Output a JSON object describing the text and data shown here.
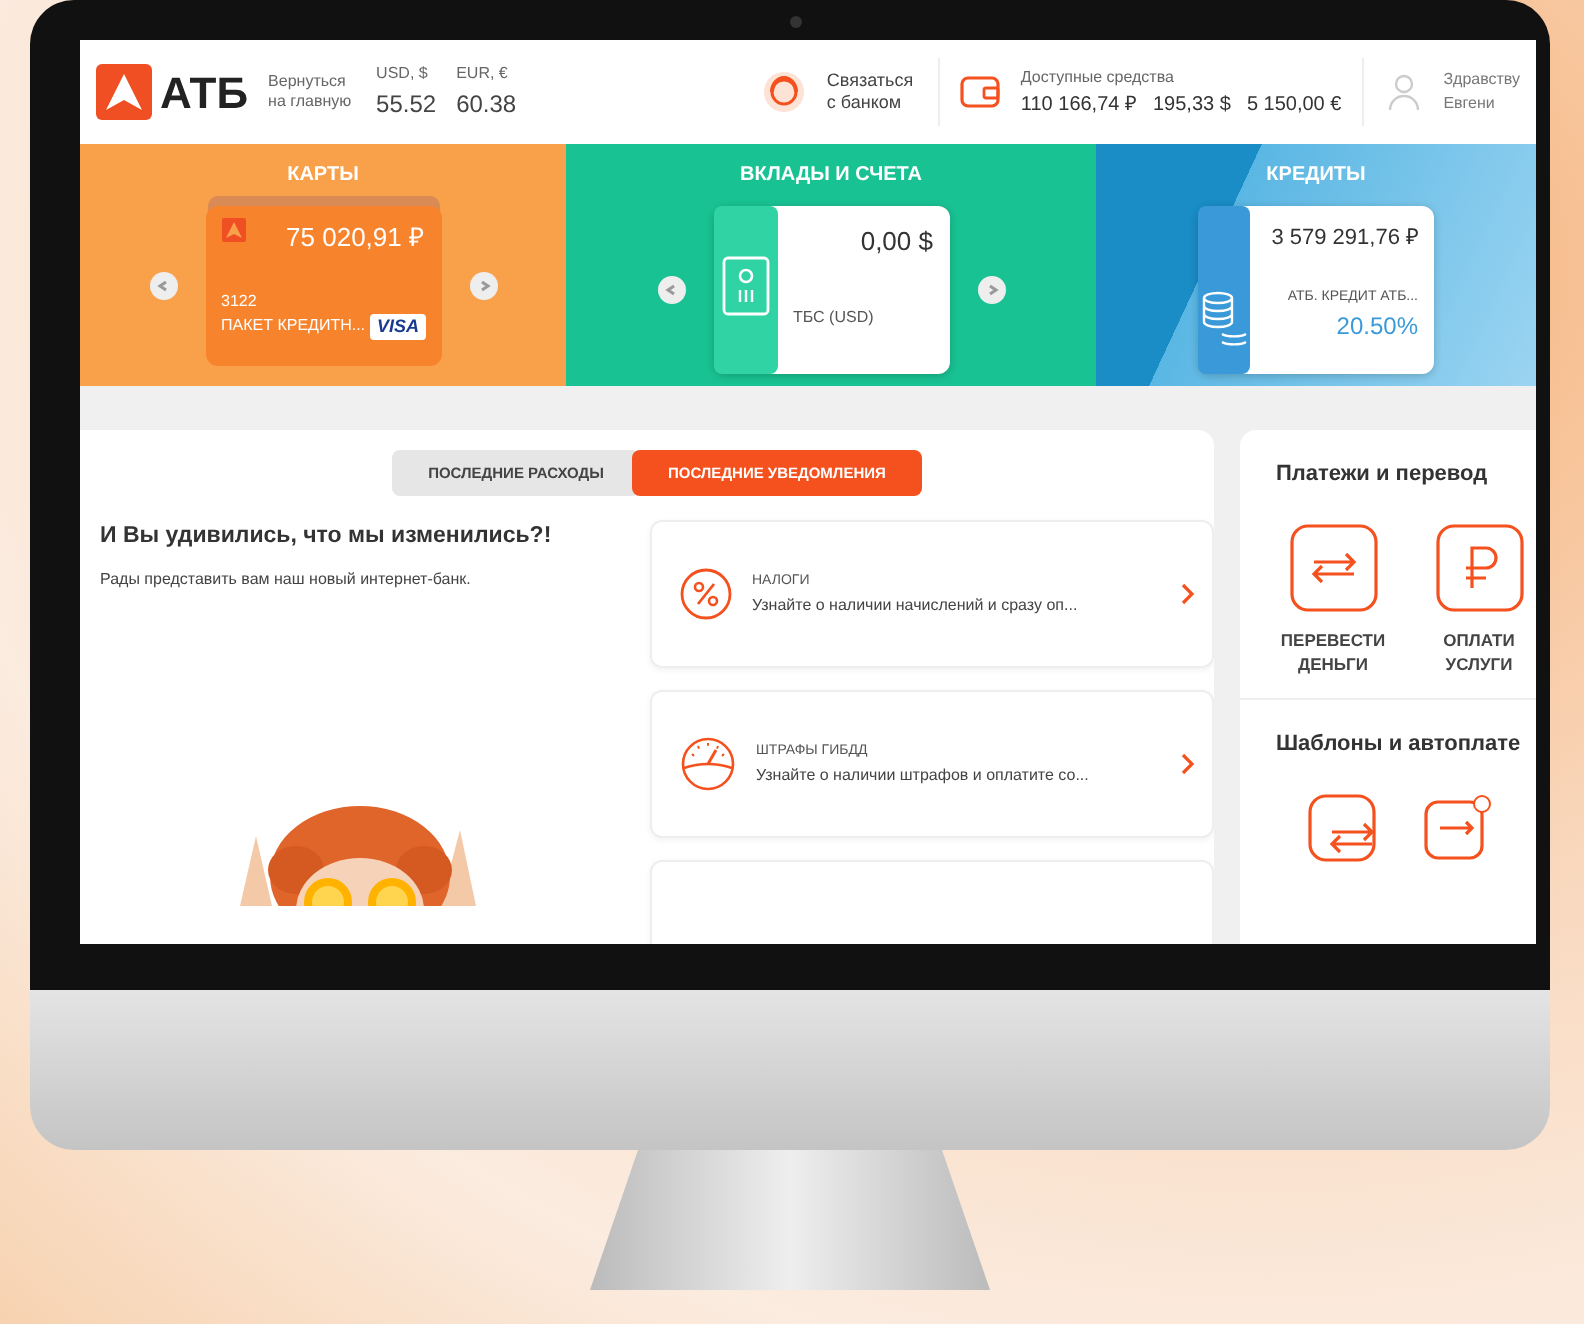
{
  "header": {
    "logo": "АТБ",
    "back_link": "Вернуться на главную",
    "rates": [
      {
        "label": "USD, $",
        "value": "55.52"
      },
      {
        "label": "EUR, €",
        "value": "60.38"
      }
    ],
    "contact": "Связаться с банком",
    "funds": {
      "label": "Доступные средства",
      "amounts": [
        "110 166,74 ₽",
        "195,33 $",
        "5 150,00 €"
      ]
    },
    "user": {
      "greeting": "Здравству",
      "name": "Евгени"
    }
  },
  "products": [
    {
      "kind": "cards",
      "title": "КАРТЫ",
      "amount": "75 020,91 ₽",
      "number": "3122",
      "name": "ПАКЕТ КРЕДИТН...",
      "brand": "VISA"
    },
    {
      "kind": "deposits",
      "title": "ВКЛАДЫ И СЧЕТА",
      "amount": "0,00 $",
      "name": "ТБС (USD)"
    },
    {
      "kind": "loans",
      "title": "КРЕДИТЫ",
      "amount": "3 579 291,76 ₽",
      "name": "АТБ. КРЕДИТ АТБ...",
      "rate": "20.50%"
    }
  ],
  "tabs": [
    {
      "label": "ПОСЛЕДНИЕ РАСХОДЫ",
      "selected": false
    },
    {
      "label": "ПОСЛЕДНИЕ УВЕДОМЛЕНИЯ",
      "selected": true
    }
  ],
  "promo": {
    "title": "И Вы удивились, что мы изменились?!",
    "text": "Рады представить вам наш новый интернет-банк."
  },
  "notifications": [
    {
      "kind": "percent",
      "title": "НАЛОГИ",
      "text": "Узнайте о наличии начислений и сразу оп..."
    },
    {
      "kind": "speedometer",
      "title": "ШТРАФЫ ГИБДД",
      "text": "Узнайте о наличии штрафов и оплатите со..."
    }
  ],
  "payments": {
    "title": "Платежи и перевод",
    "actions": [
      {
        "kind": "transfer",
        "label": "ПЕРЕВЕСТИ ДЕНЬГИ"
      },
      {
        "kind": "ruble",
        "label": "ОПЛАТИ УСЛУГИ"
      }
    ]
  },
  "templates": {
    "title": "Шаблоны и автоплате",
    "items": [
      {
        "kind": "transfer"
      },
      {
        "kind": "transfer-clock"
      }
    ]
  }
}
